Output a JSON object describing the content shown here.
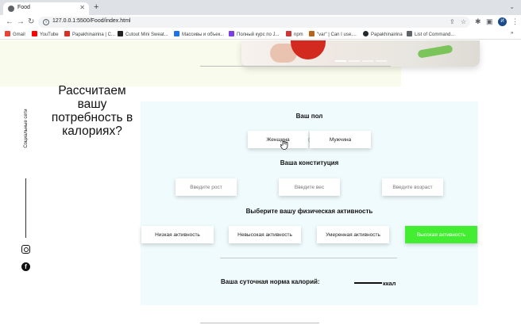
{
  "browser": {
    "tab_title": "Food",
    "new_tab_label": "+",
    "url": "127.0.0.1:5500/Food/index.html",
    "profile_initial": "И",
    "bookmarks": [
      {
        "label": "Gmail",
        "color": "#ea4335"
      },
      {
        "label": "YouTube",
        "color": "#ff0000"
      },
      {
        "label": "Papakhinairina | C...",
        "color": "#d93025"
      },
      {
        "label": "Cutout Mini Sweat...",
        "color": "#222222"
      },
      {
        "label": "Массивы и объек...",
        "color": "#1a73e8"
      },
      {
        "label": "Полный курс по J...",
        "color": "#7b3fe4"
      },
      {
        "label": "npm",
        "color": "#cb3837"
      },
      {
        "label": "\"var\" | Can I use....",
        "color": "#b5651d"
      },
      {
        "label": "Papakhinairina",
        "color": "#24292e"
      },
      {
        "label": "List of Command...",
        "color": "#5f6368"
      }
    ]
  },
  "page": {
    "calc_title": "Рассчитаем вашу потребность в калориях?",
    "social_label": "Социальные сети",
    "gender": {
      "heading": "Ваш пол",
      "female": "Женщина",
      "male": "Мужчина"
    },
    "constitution": {
      "heading": "Ваша конституция",
      "height_placeholder": "Введите рост",
      "weight_placeholder": "Введите вес",
      "age_placeholder": "Введите возраст"
    },
    "activity": {
      "heading": "Выберите вашу физическая активность",
      "low": "Низкая активность",
      "medium_low": "Невысокая активность",
      "moderate": "Умеренная активность",
      "high": "Высокая активность",
      "selected": "Высокая активность",
      "active_color": "#43ed32"
    },
    "result": {
      "label": "Ваша суточная норма калорий:",
      "value": "",
      "unit": "ккал"
    }
  }
}
